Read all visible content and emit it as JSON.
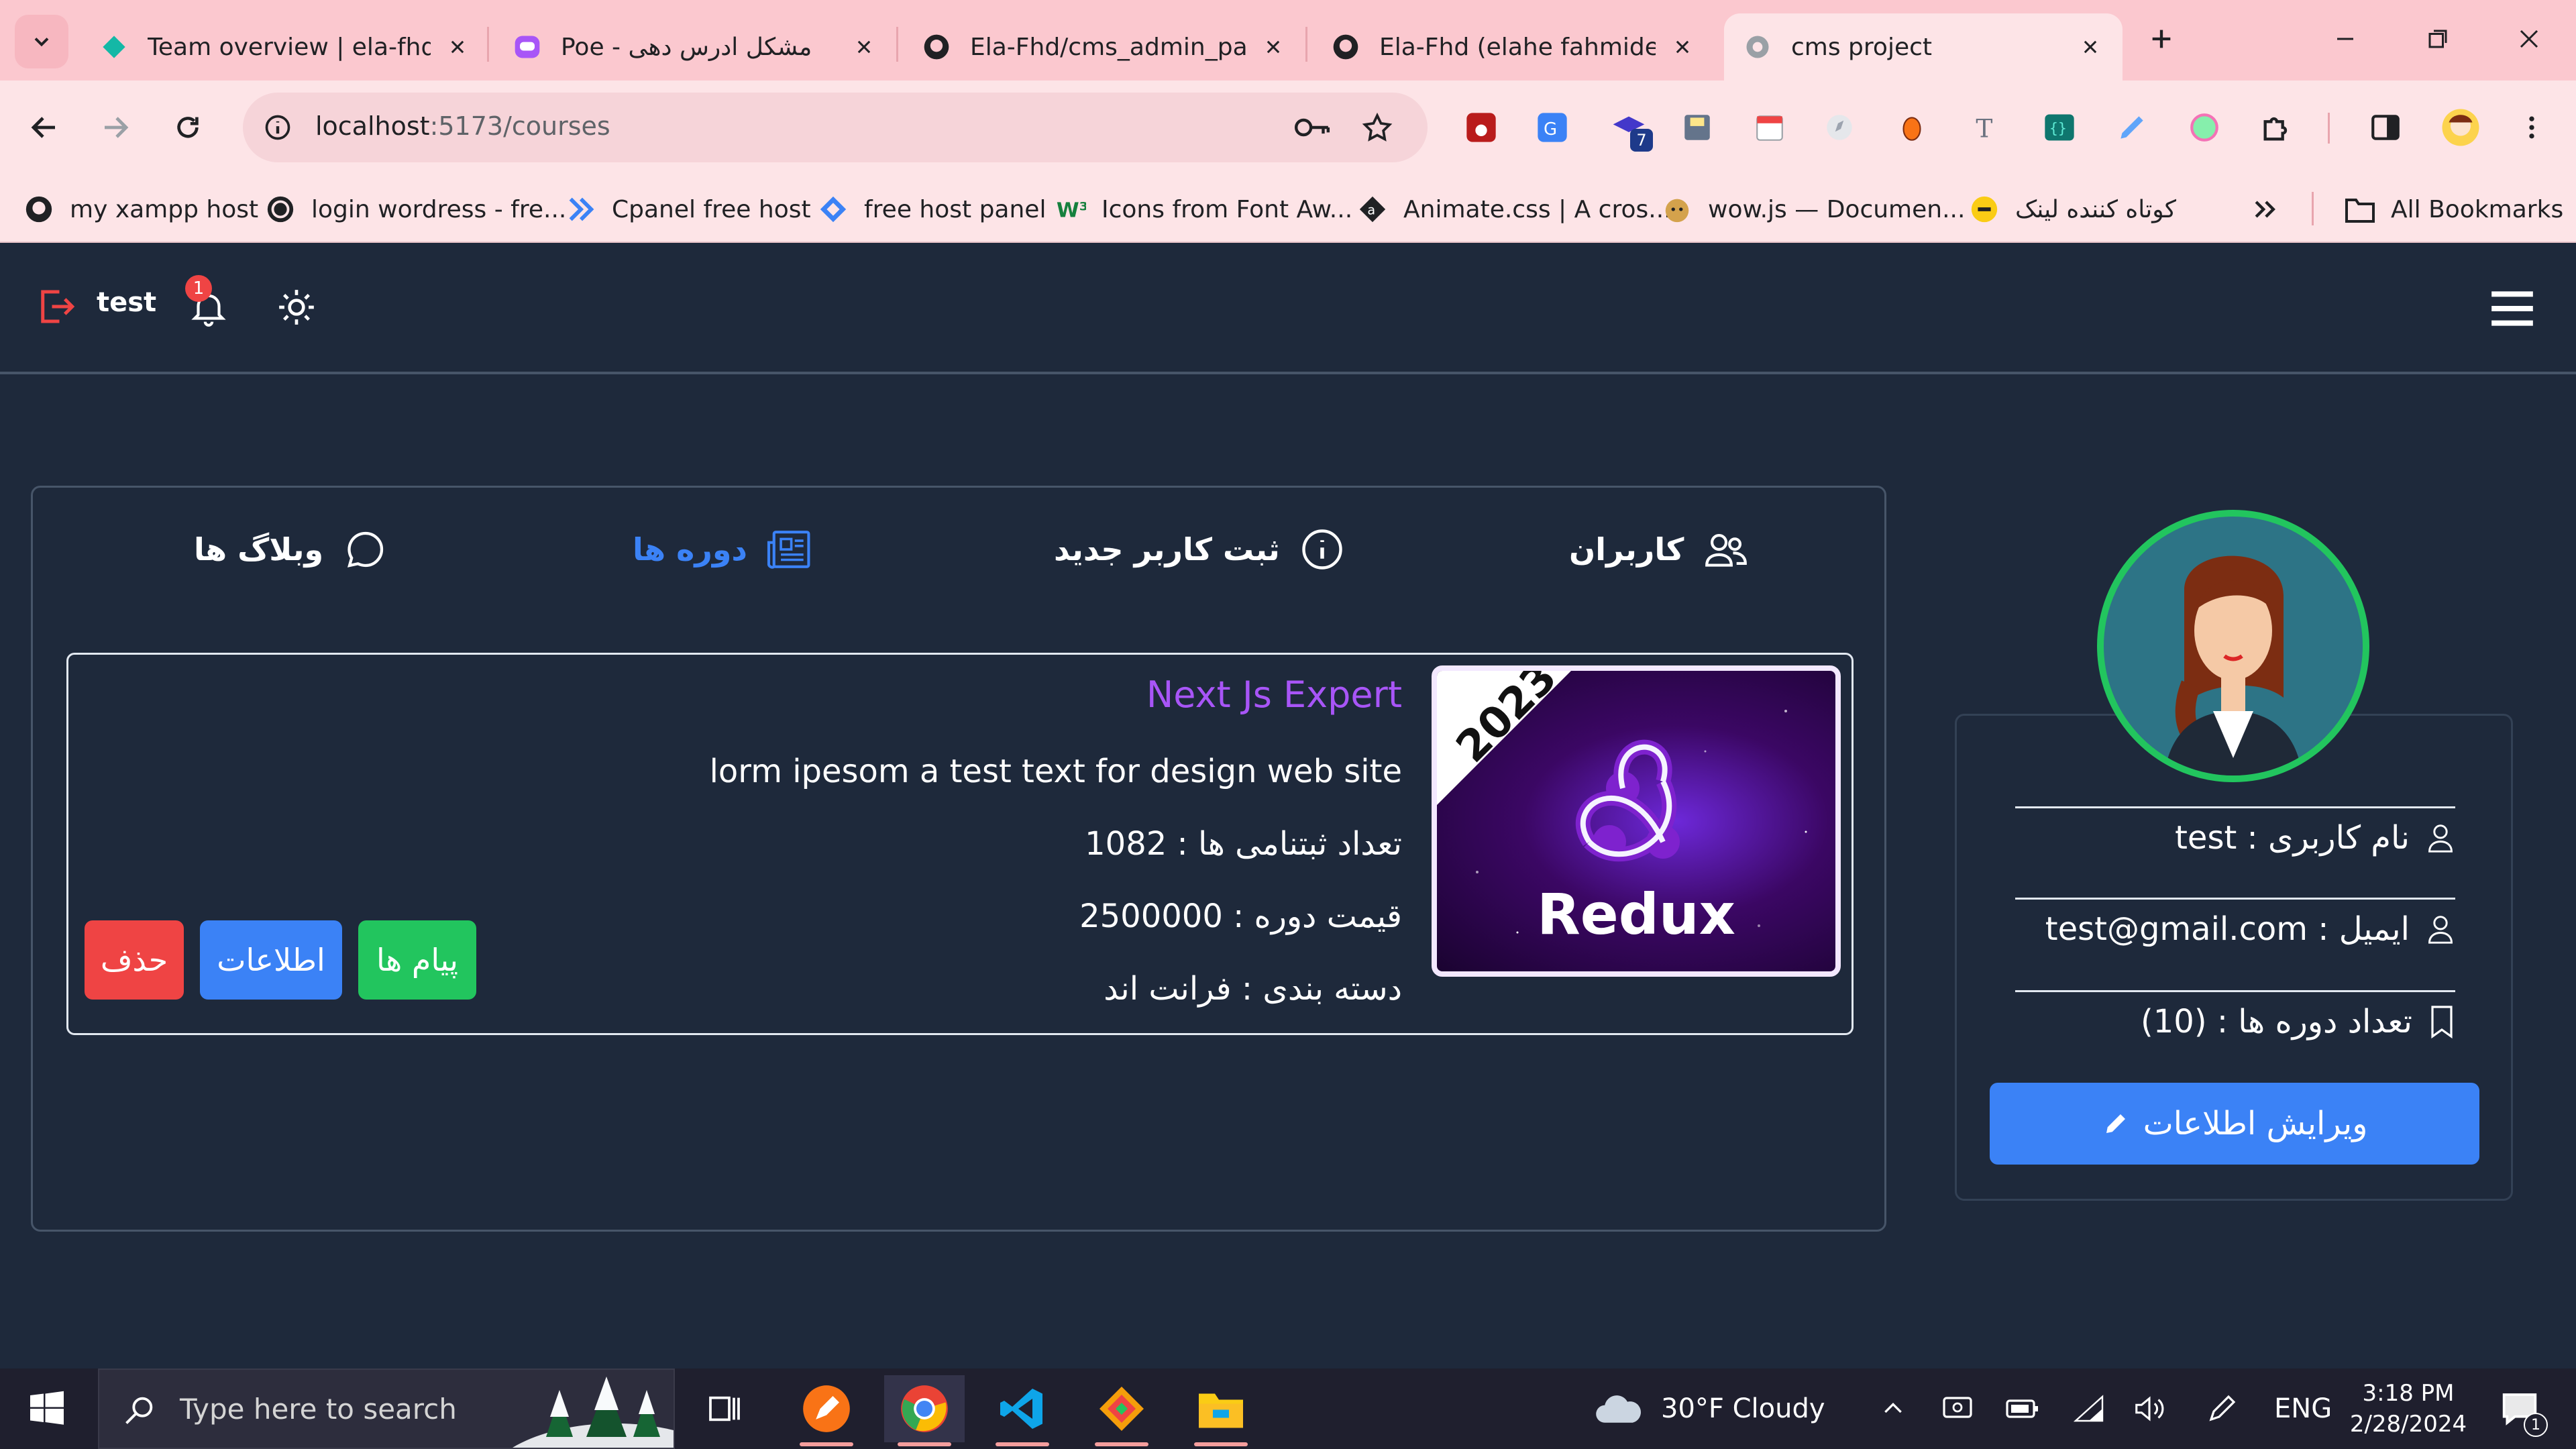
{
  "browser": {
    "tabs": [
      {
        "title": "Team overview | ela-fhd |",
        "icon": "diamond-favicon"
      },
      {
        "title": "Poe - مشکل ادرس دهی",
        "icon": "poe-favicon"
      },
      {
        "title": "Ela-Fhd/cms_admin_pane",
        "icon": "github-favicon"
      },
      {
        "title": "Ela-Fhd (elahe fahmideh)",
        "icon": "github-favicon"
      },
      {
        "title": "cms project",
        "icon": "globe-favicon",
        "active": true
      }
    ],
    "url_host": "localhost",
    "url_path": ":5173/courses",
    "extension_badge": "7",
    "bookmarks": [
      {
        "label": "my xampp host",
        "icon": "github-icon"
      },
      {
        "label": "login wordress - fre...",
        "icon": "wordpress-icon"
      },
      {
        "label": "Cpanel free host",
        "icon": "cpanel-icon"
      },
      {
        "label": "free host panel",
        "icon": "panel-icon"
      },
      {
        "label": "Icons from Font Aw...",
        "icon": "w3-icon"
      },
      {
        "label": "Animate.css | A cros...",
        "icon": "animate-icon"
      },
      {
        "label": "wow.js — Documen...",
        "icon": "doge-icon"
      },
      {
        "label": "کوتاه کننده لینک",
        "icon": "link-icon"
      }
    ],
    "all_bookmarks": "All Bookmarks"
  },
  "app": {
    "header": {
      "username": "test",
      "notification_count": "1"
    },
    "nav": {
      "users": "کاربران",
      "register": "ثبت کاربر جدید",
      "courses": "دوره ها",
      "blogs": "وبلاگ ها"
    },
    "course": {
      "title": "Next Js Expert",
      "description": "lorm ipesom a test text for design web site",
      "registrations": "تعداد ثبتنامی ها : 1082",
      "price": "قیمت دوره : 2500000",
      "category": "دسته بندی : فرانت اند",
      "image_year": "2023",
      "image_brand": "Redux",
      "btn_messages": "پیام ها",
      "btn_info": "اطلاعات",
      "btn_delete": "حذف"
    },
    "profile": {
      "username_line": "نام کاربری : test",
      "email_line": "ایمیل : test@gmail.com",
      "courses_line": "تعداد دوره ها : (10)",
      "edit_button": "ویرایش اطلاعات"
    }
  },
  "taskbar": {
    "search_placeholder": "Type here to search",
    "weather": "30°F  Cloudy",
    "language": "ENG",
    "time": "3:18 PM",
    "date": "2/28/2024",
    "notif_count": "1"
  },
  "colors": {
    "accent_blue": "#3b82f6",
    "success_green": "#22c55e",
    "danger_red": "#ef4444",
    "course_title_purple": "#a855f7",
    "app_bg": "#1e293b",
    "chrome_pink": "#fbc8cf"
  }
}
